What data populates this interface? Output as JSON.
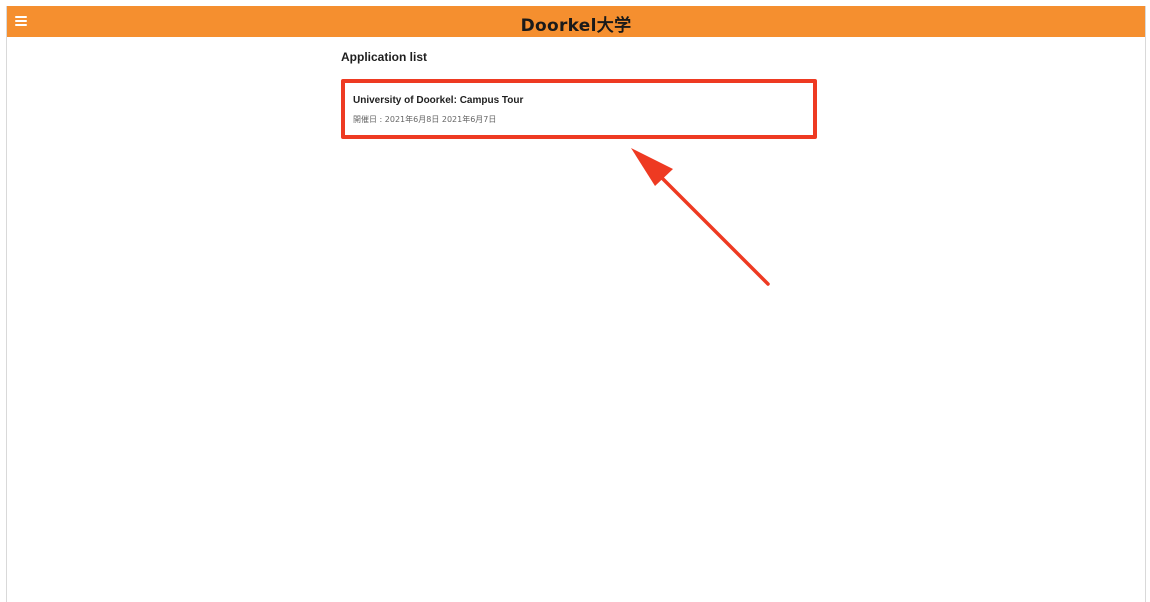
{
  "header": {
    "app_title": "Doorkel大学",
    "menu_icon": "hamburger-menu-icon",
    "bar_color": "#f58f2f"
  },
  "main": {
    "section_title": "Application list",
    "applications": [
      {
        "title": "University of Doorkel: Campus Tour",
        "dates": "開催日 : 2021年6月8日 2021年6月7日"
      }
    ]
  },
  "annotation": {
    "highlight_color": "#ee3a22",
    "arrow_icon": "red-arrow-icon"
  }
}
